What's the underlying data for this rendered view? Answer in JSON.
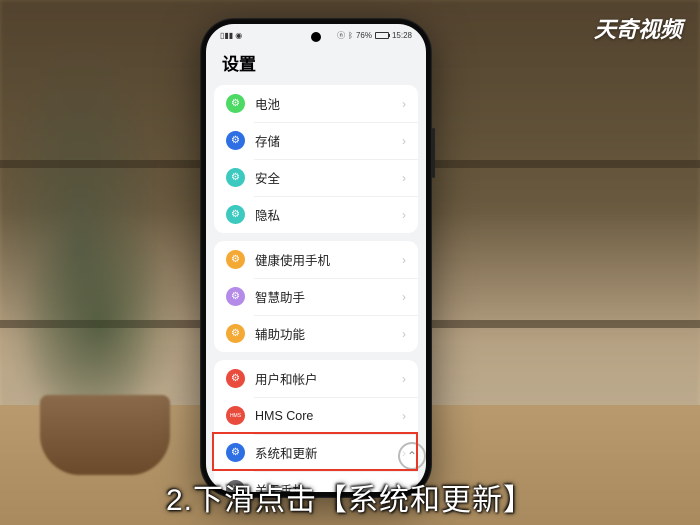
{
  "watermark": "天奇视频",
  "caption": "2.下滑点击【系统和更新】",
  "status": {
    "battery_pct": "76%",
    "time": "15:28"
  },
  "page_title": "设置",
  "groups": [
    {
      "rows": [
        {
          "label": "电池",
          "icon_color": "#4cd964",
          "icon_name": "battery-icon"
        },
        {
          "label": "存储",
          "icon_color": "#2f6fe4",
          "icon_name": "storage-icon"
        },
        {
          "label": "安全",
          "icon_color": "#3cc9c0",
          "icon_name": "security-icon"
        },
        {
          "label": "隐私",
          "icon_color": "#3cc9c0",
          "icon_name": "privacy-icon"
        }
      ]
    },
    {
      "rows": [
        {
          "label": "健康使用手机",
          "icon_color": "#f4a935",
          "icon_name": "digital-balance-icon"
        },
        {
          "label": "智慧助手",
          "icon_color": "#b48be8",
          "icon_name": "assistant-icon"
        },
        {
          "label": "辅助功能",
          "icon_color": "#f4a935",
          "icon_name": "accessibility-icon"
        }
      ]
    },
    {
      "rows": [
        {
          "label": "用户和帐户",
          "icon_color": "#e94b3c",
          "icon_name": "users-icon"
        },
        {
          "label": "HMS Core",
          "icon_color": "#e94b3c",
          "icon_name": "hms-icon",
          "icon_text": "HMS"
        },
        {
          "label": "系统和更新",
          "icon_color": "#2f6fe4",
          "icon_name": "system-update-icon",
          "highlight": true
        },
        {
          "label": "关于手机",
          "icon_color": "#6b6b6f",
          "icon_name": "about-phone-icon"
        }
      ]
    }
  ]
}
